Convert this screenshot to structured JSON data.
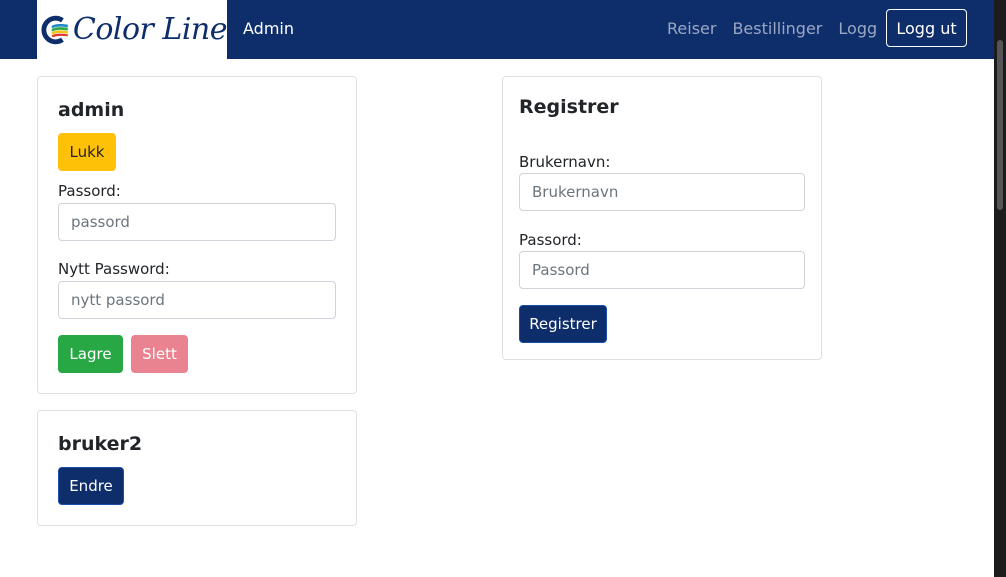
{
  "navbar": {
    "brand_text": "Color Line",
    "admin_label": "Admin",
    "links": [
      "Reiser",
      "Bestillinger",
      "Logg"
    ],
    "logout_label": "Logg ut"
  },
  "user_card_admin": {
    "title": "admin",
    "close_label": "Lukk",
    "password_label": "Passord:",
    "password_placeholder": "passord",
    "new_password_label": "Nytt Password:",
    "new_password_placeholder": "nytt passord",
    "save_label": "Lagre",
    "delete_label": "Slett"
  },
  "user_card_bruker2": {
    "title": "bruker2",
    "edit_label": "Endre"
  },
  "register_card": {
    "title": "Registrer",
    "username_label": "Brukernavn:",
    "username_placeholder": "Brukernavn",
    "password_label": "Passord:",
    "password_placeholder": "Passord",
    "submit_label": "Registrer"
  },
  "colors": {
    "navbar": "#0e2d6b",
    "yellow": "#ffc107",
    "green": "#28a745",
    "red_disabled": "#e9838f"
  }
}
